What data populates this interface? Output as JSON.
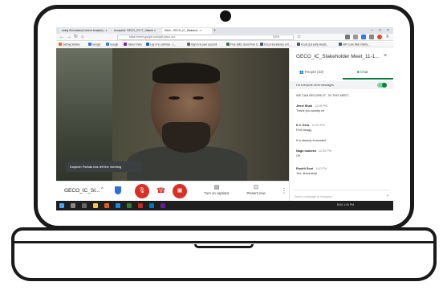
{
  "browser": {
    "tabs": [
      {
        "label": "ankaj Shrivastav(Content Analytic) - x",
        "active": false
      },
      {
        "label": "Accepted: GECO_CS IT_Stakeh x",
        "active": false
      },
      {
        "label": "Meet - GECO_IC_Stakehol... x",
        "active": true
      }
    ],
    "new_tab": "+",
    "url": "https://meet.google.com/gdf-qxwo-uxc",
    "zoom": "110%",
    "bookmarks": [
      "Getting Started",
      "Google",
      "Google",
      "Yahoo! India",
      "Log in to continue - L...",
      "Sign in to your account",
      "Free SMS, Send Free S...",
      "KCust Excellence a R...",
      "Kcust (1st party Assist...",
      "ISPI Care Web Interfa..."
    ]
  },
  "meet": {
    "toast": "Kalpesh Pathak has left the meeting",
    "meeting_name": "GECO_IC_St...",
    "captions_label": "Turn on captions",
    "present_label": "Present now",
    "chat": {
      "title": "GECO_IC_Stakeholder Meet_11-1...",
      "people_tab": "People (33)",
      "chat_tab": "Chat",
      "allow_label": "Let everyone send messages",
      "messages": [
        {
          "sender": "",
          "time": "",
          "text": "WE CAN RECORD IT , IN THIS MEET..."
        },
        {
          "sender": "Jheel Shah",
          "time": "12:58 PM",
          "text": "Thank you sandip sir"
        },
        {
          "sender": "K C Gera",
          "time": "12:59 PM",
          "text": "Prof Neagy,"
        },
        {
          "sender": "",
          "time": "",
          "text": "It is already forwarded"
        },
        {
          "sender": "Nagu mukesh",
          "time": "12:59 PM",
          "text": "OK"
        },
        {
          "sender": "Rushit Soni",
          "time": "1:00 PM",
          "text": "Yes, absolutely!"
        }
      ],
      "input_placeholder": "Send a message to everyone"
    }
  },
  "taskbar": {
    "tray_text": "ENG  1:00 PM"
  },
  "colors": {
    "red": "#d93025",
    "green": "#0b8043",
    "blue": "#2b6fd6"
  }
}
